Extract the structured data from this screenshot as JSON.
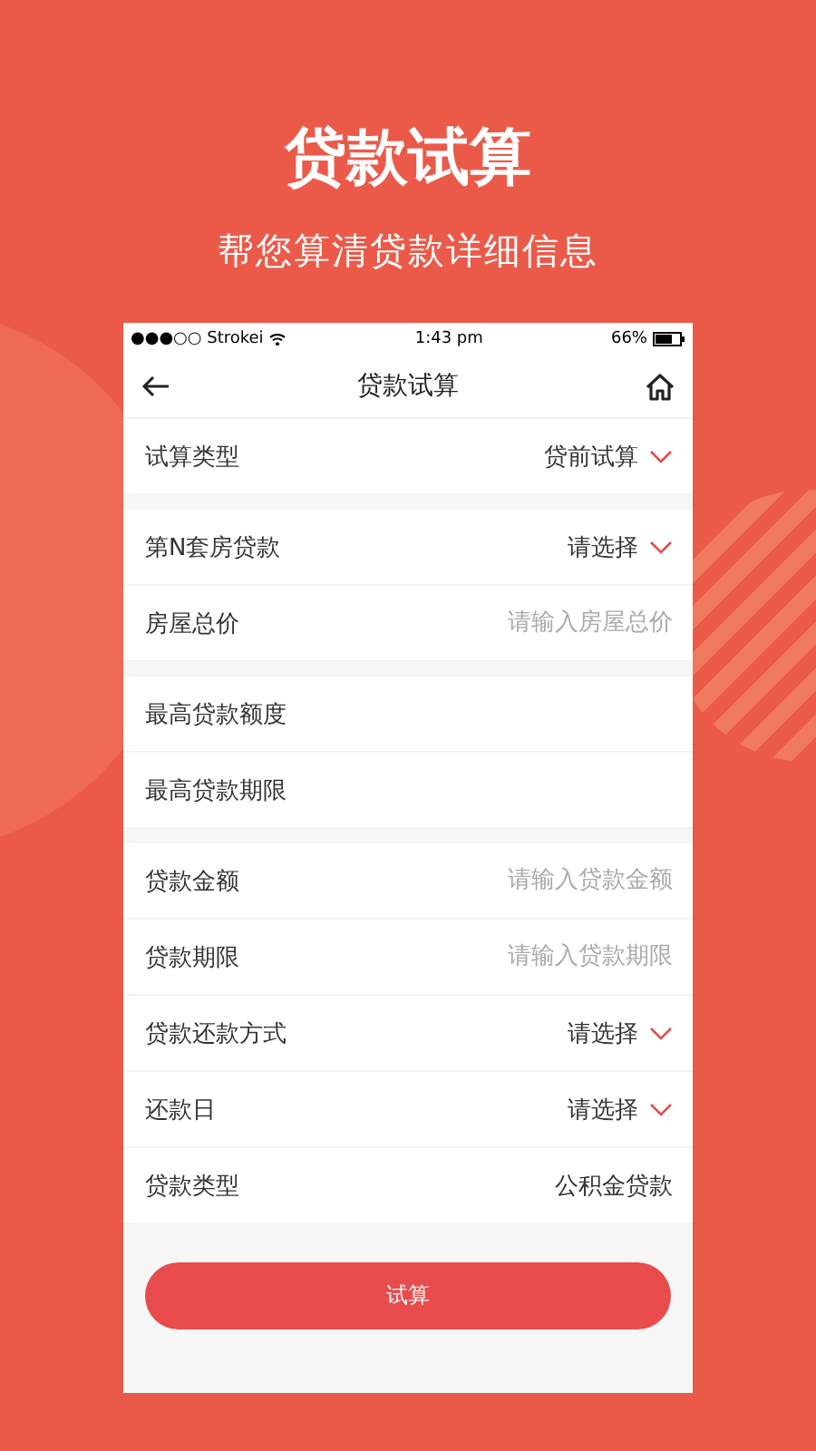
{
  "headline": "贷款试算",
  "subtitle": "帮您算清贷款详细信息",
  "status_bar": {
    "carrier": "●●●○○ Strokei",
    "time": "1:43 pm",
    "battery": "66%"
  },
  "nav": {
    "title": "贷款试算"
  },
  "sections": [
    {
      "rows": [
        {
          "kind": "select",
          "label": "试算类型",
          "value": "贷前试算"
        }
      ]
    },
    {
      "rows": [
        {
          "kind": "select",
          "label": "第N套房贷款",
          "value": "请选择"
        },
        {
          "kind": "input",
          "label": "房屋总价",
          "placeholder": "请输入房屋总价"
        }
      ]
    },
    {
      "rows": [
        {
          "kind": "label",
          "label": "最高贷款额度"
        },
        {
          "kind": "label",
          "label": "最高贷款期限"
        }
      ]
    },
    {
      "rows": [
        {
          "kind": "input",
          "label": "贷款金额",
          "placeholder": "请输入贷款金额"
        },
        {
          "kind": "input",
          "label": "贷款期限",
          "placeholder": "请输入贷款期限"
        },
        {
          "kind": "select",
          "label": "贷款还款方式",
          "value": "请选择"
        },
        {
          "kind": "select",
          "label": "还款日",
          "value": "请选择"
        },
        {
          "kind": "value",
          "label": "贷款类型",
          "value": "公积金贷款"
        }
      ]
    }
  ],
  "submit": "试算"
}
